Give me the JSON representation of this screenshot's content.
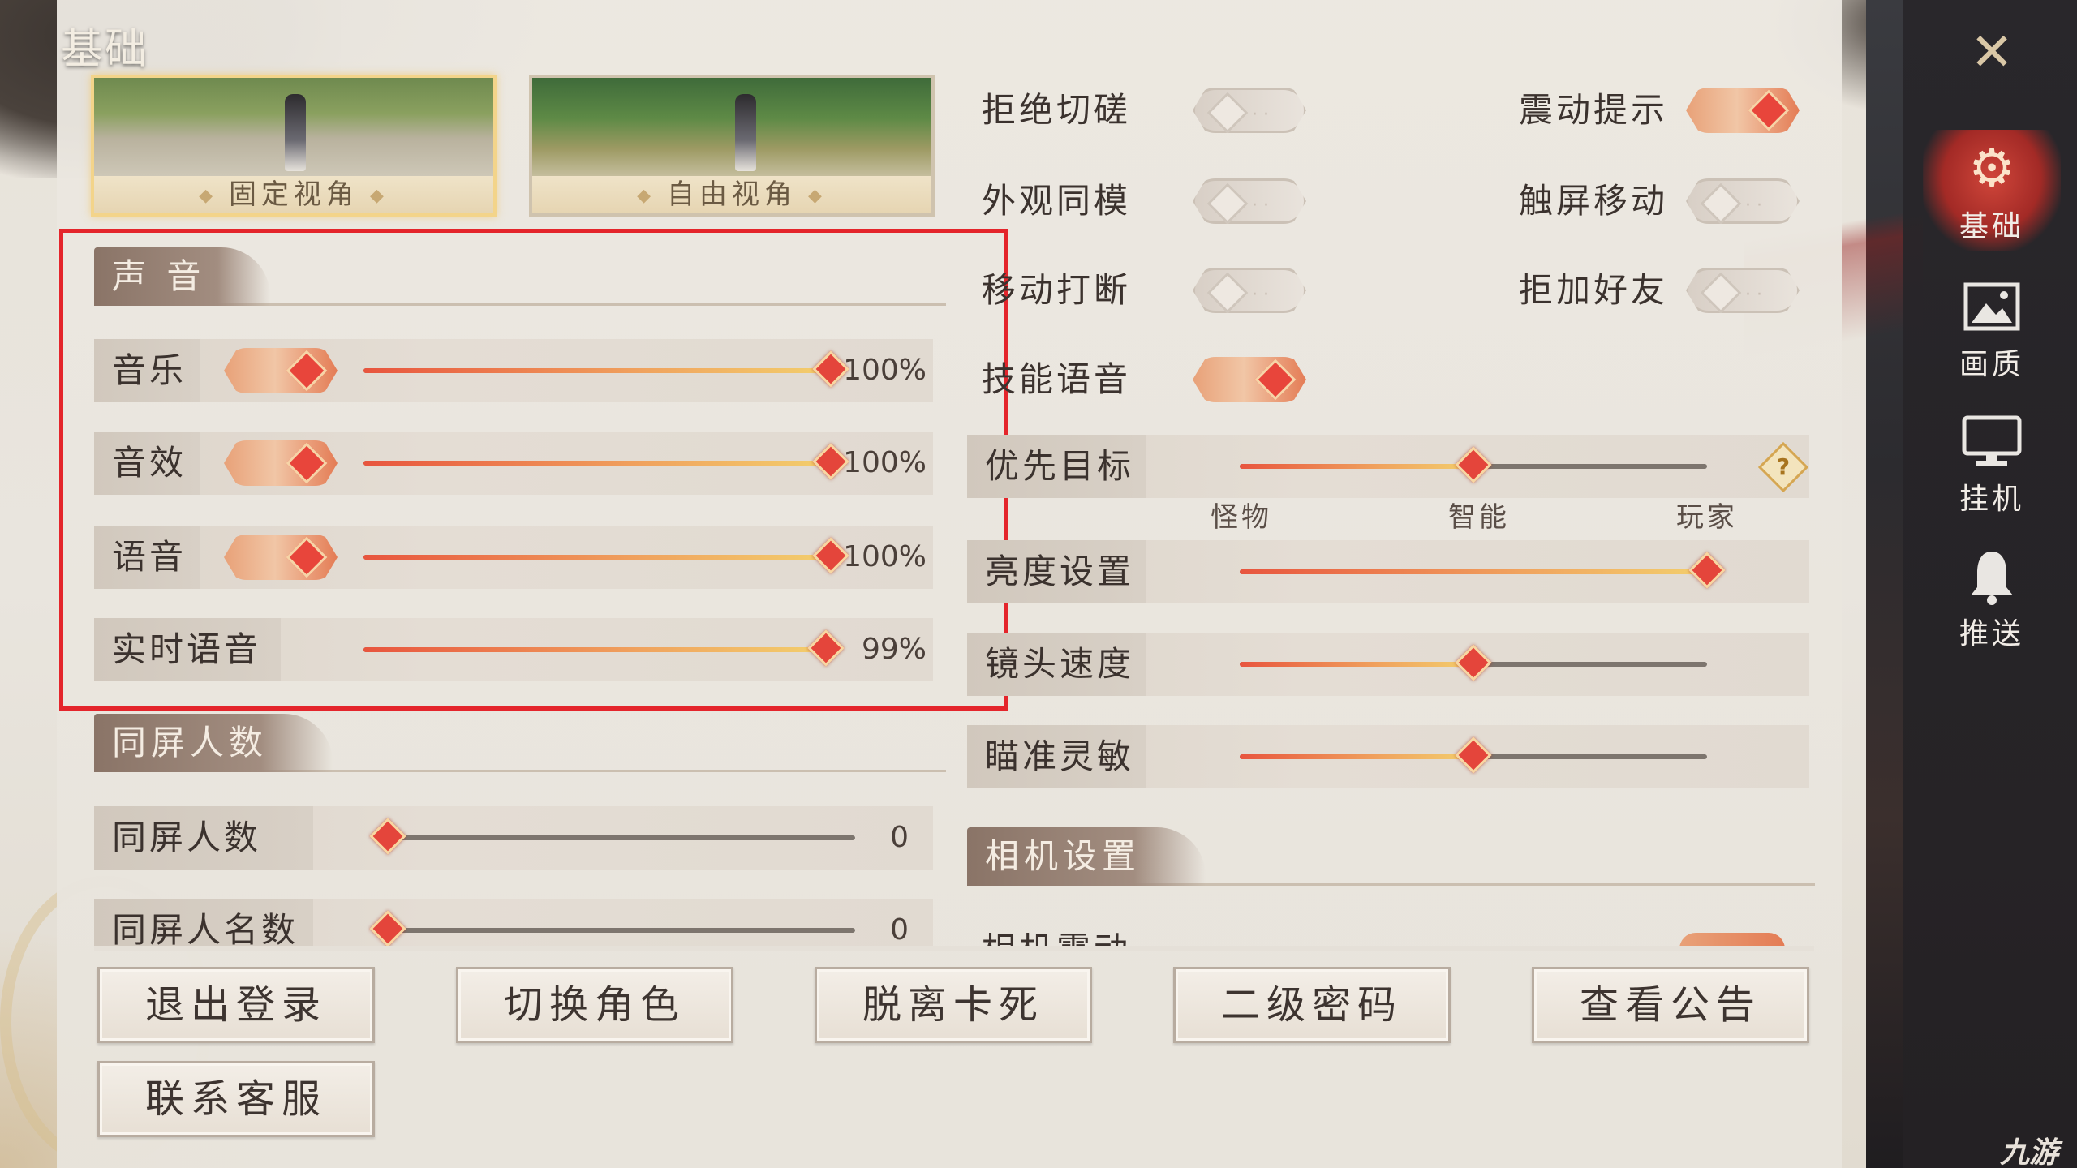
{
  "page": {
    "title": "基础"
  },
  "camera": {
    "fixed_label": "固定视角",
    "free_label": "自由视角"
  },
  "sound": {
    "header": "声 音",
    "rows": [
      {
        "label": "音乐",
        "toggle": "on",
        "value": 1.0,
        "value_text": "100%"
      },
      {
        "label": "音效",
        "toggle": "on",
        "value": 1.0,
        "value_text": "100%"
      },
      {
        "label": "语音",
        "toggle": "on",
        "value": 1.0,
        "value_text": "100%"
      },
      {
        "label": "实时语音",
        "value": 0.99,
        "value_text": "99%"
      }
    ]
  },
  "crowd": {
    "header": "同屏人数",
    "rows": [
      {
        "label": "同屏人数",
        "value": 0,
        "value_text": "0"
      },
      {
        "label": "同屏人名数",
        "value": 0,
        "value_text": "0"
      }
    ]
  },
  "toggles_left": [
    {
      "label": "拒绝切磋",
      "state": "off"
    },
    {
      "label": "外观同模",
      "state": "off"
    },
    {
      "label": "移动打断",
      "state": "off"
    },
    {
      "label": "技能语音",
      "state": "on"
    }
  ],
  "toggles_right": [
    {
      "label": "震动提示",
      "state": "on"
    },
    {
      "label": "触屏移动",
      "state": "off"
    },
    {
      "label": "拒加好友",
      "state": "off"
    }
  ],
  "priority_target": {
    "label": "优先目标",
    "value": 0.5,
    "ticks": [
      "怪物",
      "智能",
      "玩家"
    ],
    "help": "?"
  },
  "brightness": {
    "label": "亮度设置",
    "value": 1.0
  },
  "camera_speed": {
    "label": "镜头速度",
    "value": 0.5
  },
  "aim_sensitivity": {
    "label": "瞄准灵敏",
    "value": 0.5
  },
  "camera_settings": {
    "header": "相机设置",
    "partial_label": "相机震动"
  },
  "buttons": {
    "logout": "退出登录",
    "switch_role": "切换角色",
    "unstuck": "脱离卡死",
    "second_password": "二级密码",
    "notice": "查看公告",
    "support": "联系客服"
  },
  "nav": {
    "close_icon": "close-icon",
    "items": [
      {
        "label": "基础",
        "icon": "gear-icon",
        "active": true
      },
      {
        "label": "画质",
        "icon": "image-icon",
        "active": false
      },
      {
        "label": "挂机",
        "icon": "monitor-icon",
        "active": false
      },
      {
        "label": "推送",
        "icon": "bell-icon",
        "active": false
      }
    ]
  },
  "watermark": "九游",
  "colors": {
    "accent": "#e4453b",
    "highlight_box": "#e4252b",
    "slider_track": "#7d756e"
  }
}
